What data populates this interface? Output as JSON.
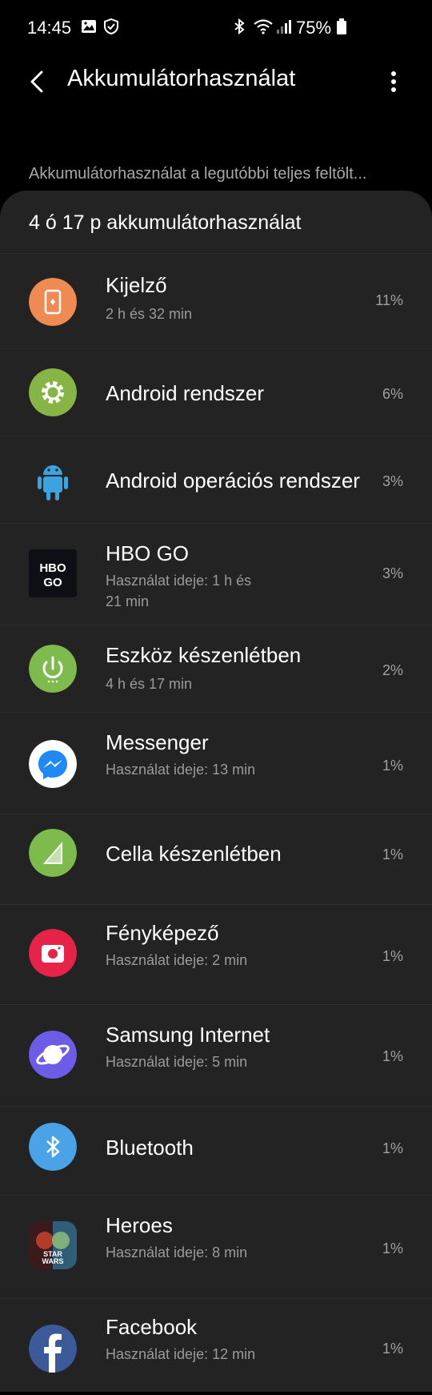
{
  "status_bar": {
    "time": "14:45",
    "battery": "75%"
  },
  "app_bar": {
    "title": "Akkumulátorhasználat"
  },
  "subtitle": "Akkumulátorhasználat a legutóbbi teljes feltölt...",
  "card": {
    "title": "4 ó 17 p akkumulátorhasználat"
  },
  "items": [
    {
      "name": "Kijelző",
      "sub": "2 h és 32 min",
      "pct": "11%"
    },
    {
      "name": "Android rendszer",
      "sub": "",
      "pct": "6%"
    },
    {
      "name": "Android operációs rendszer",
      "sub": "",
      "pct": "3%"
    },
    {
      "name": "HBO GO",
      "sub": "Használat ideje: 1 h és 21 min",
      "pct": "3%",
      "icon_text_1": "HBO",
      "icon_text_2": "GO"
    },
    {
      "name": "Eszköz készenlétben",
      "sub": "4 h és 17 min",
      "pct": "2%"
    },
    {
      "name": "Messenger",
      "sub": "Használat ideje: 13 min",
      "pct": "1%"
    },
    {
      "name": "Cella készenlétben",
      "sub": "",
      "pct": "1%"
    },
    {
      "name": "Fényképező",
      "sub": "Használat ideje: 2 min",
      "pct": "1%"
    },
    {
      "name": "Samsung Internet",
      "sub": "Használat ideje: 5 min",
      "pct": "1%"
    },
    {
      "name": "Bluetooth",
      "sub": "",
      "pct": "1%"
    },
    {
      "name": "Heroes",
      "sub": "Használat ideje: 8 min",
      "pct": "1%",
      "icon_text_1": "STAR",
      "icon_text_2": "WARS"
    },
    {
      "name": "Facebook",
      "sub": "Használat ideje: 12 min",
      "pct": "1%"
    }
  ],
  "colors": {
    "background": "#000000",
    "card": "#232323",
    "kijelzo": "#ef8a52",
    "android_system": "#86b545",
    "android_os": "#3ba3dd",
    "standby": "#7dbb4c",
    "messenger": "#ffffff",
    "cell": "#7dbb4c",
    "camera": "#e8234a",
    "internet": "#6c5ce7",
    "bluetooth": "#4aa3e6",
    "facebook": "#3c5a9a"
  },
  "icons": [
    "display-icon",
    "gear-icon",
    "android-robot-icon",
    "hbo-go-icon",
    "power-icon",
    "messenger-icon",
    "signal-icon",
    "camera-icon",
    "samsung-internet-icon",
    "bluetooth-icon",
    "heroes-icon",
    "facebook-icon"
  ]
}
